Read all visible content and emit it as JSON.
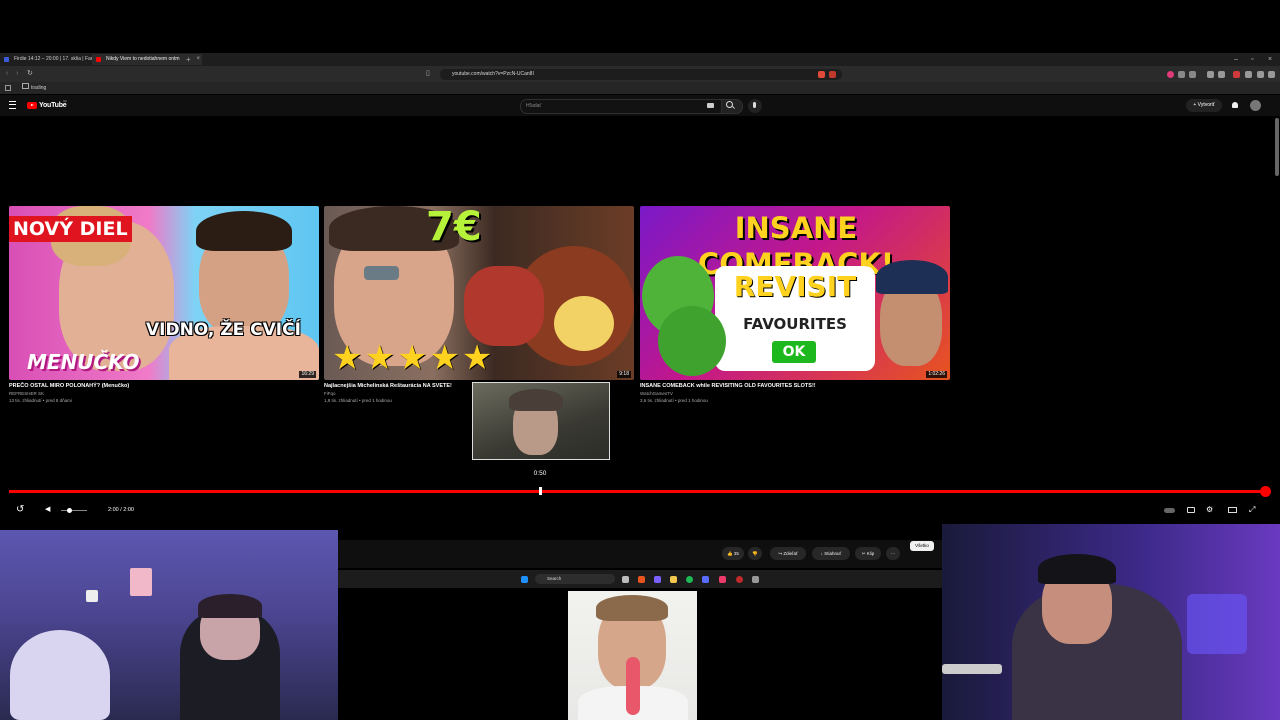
{
  "browser": {
    "tabs": [
      {
        "label": "Firdie 14:12 – 20:00 | 17. sklia | Fare"
      },
      {
        "label": "Nikdy Viem to nedotiahnem ontm"
      }
    ],
    "url": "youtube.com/watch?v=PzcN-UCan8I",
    "bookmark": "trading"
  },
  "youtube": {
    "logo": "YouTube",
    "region": "SK",
    "search_placeholder": "Hľadať",
    "create_label": "+ Vytvoriť"
  },
  "endscreen": {
    "cards": [
      {
        "title": "PREČO OSTAL MIRO POLONAHÝ? (Menučko)",
        "channel": "REFRESHER SK",
        "meta": "13 tis. zhliadnutí • pred 8 dňami",
        "duration": "16:29",
        "thumb_text": [
          "NOVÝ DIEL",
          "VIDNO, ŽE CVIČÍ",
          "MENUČKO"
        ]
      },
      {
        "title": "Najlacnejšia Michelinská Reštaurácia NA SVETE!",
        "channel": "FiFqo",
        "meta": "1,9 tis. zhliadnutí • pred 1 hodinou",
        "duration": "9:18",
        "thumb_text": [
          "7€",
          "★★★★★"
        ]
      },
      {
        "title": "INSANE COMEBACK while REVISITING OLD FAVOURITES SLOTS!!",
        "channel": "WatchGamesTV",
        "meta": "3,6 tis. zhliadnutí • pred 1 hodinou",
        "duration": "1:02:26",
        "thumb_text": [
          "INSANE COMEBACK!",
          "REVISIT",
          "FAVOURITES",
          "OK"
        ]
      }
    ]
  },
  "player": {
    "hover_time": "0:50",
    "progress": 1.0,
    "time_display": "2:00 / 2:00"
  },
  "inner_page": {
    "like_count": "35",
    "share": "Zdieľať",
    "download": "Stiahnuť",
    "clip": "Klip",
    "filter_chip": "Všetko",
    "taskbar_search": "Search"
  },
  "colors": {
    "accent": "#ff0000",
    "background": "#000000",
    "yt_header": "#0f0f0f"
  },
  "icons": [
    "menu-icon",
    "search-icon",
    "mic-icon",
    "bell-icon",
    "replay-icon",
    "volume-icon",
    "settings-icon",
    "fullscreen-icon"
  ]
}
